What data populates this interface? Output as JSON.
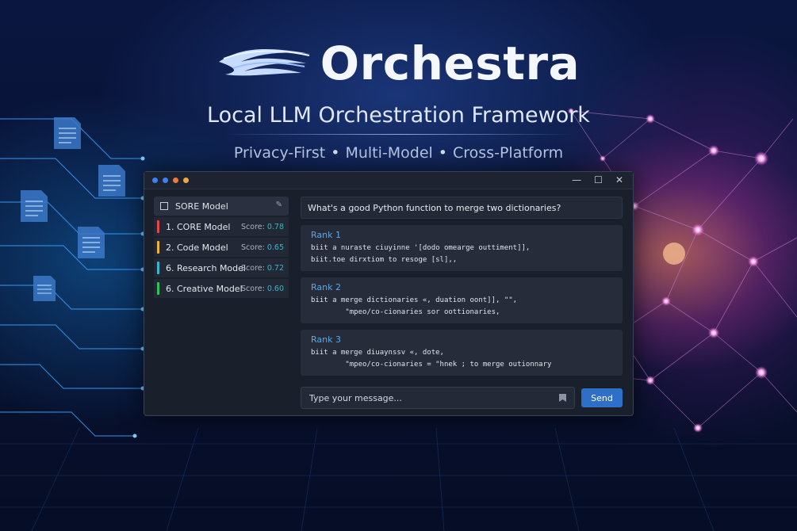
{
  "hero": {
    "title": "Orchestra",
    "tagline": "Local LLM Orchestration Framework",
    "features": [
      "Privacy-First",
      "Multi-Model",
      "Cross-Platform"
    ],
    "separator": "•"
  },
  "window": {
    "dot_colors": [
      "#3b82f6",
      "#3b82f6",
      "#ef7a3d",
      "#f2a93b"
    ],
    "controls": {
      "minimize": "—",
      "maximize": "☐",
      "close": "✕"
    }
  },
  "sidebar": {
    "header": "SORE Model",
    "edit_glyph": "✎",
    "items": [
      {
        "label": "1. CORE Model",
        "score_label": "Score:",
        "score": "0.78",
        "color": "#e24a4a"
      },
      {
        "label": "2. Code Model",
        "score_label": "Score:",
        "score": "0.65",
        "color": "#f0b43a"
      },
      {
        "label": "6. Research Model",
        "score_label": "Score:",
        "score": "0.72",
        "color": "#39b8c8"
      },
      {
        "label": "6. Creative Model",
        "score_label": "Score:",
        "score": "0.60",
        "color": "#2fc35a"
      }
    ]
  },
  "chat": {
    "query": "What's a good Python function to merge two dictionaries?",
    "ranks": [
      {
        "title": "Rank 1",
        "line1": "biit a nuraste ciuyinne '[dodo omearge outtiment]],",
        "line2": "biit.toe dirxtiom to resoge [sl],,"
      },
      {
        "title": "Rank 2",
        "line1": "biit a merge dictionaries «, duation oont]], \"\",",
        "line2": "        \"mpeo/co-cionaries sor oottionaries,"
      },
      {
        "title": "Rank 3",
        "line1": "biit a merge diuaynssv «, dote,",
        "line2": "        \"mpeo/co-cionaries = \"hnek ; to merge outionnary"
      }
    ],
    "input_placeholder": "Type your message...",
    "send_label": "Send"
  }
}
